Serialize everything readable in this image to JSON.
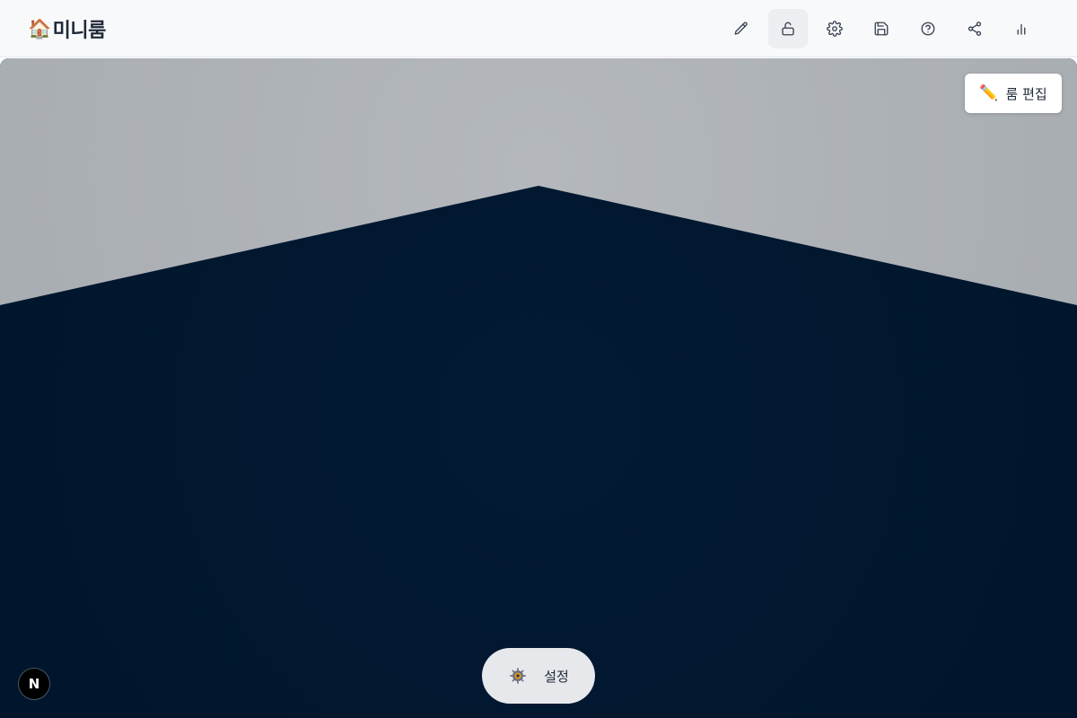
{
  "header": {
    "brand_emoji": "🏠",
    "brand_title": "미니룸",
    "toolbar": [
      {
        "icon": "pencil-icon",
        "active": false
      },
      {
        "icon": "unlock-icon",
        "active": true
      },
      {
        "icon": "gear-icon",
        "active": false
      },
      {
        "icon": "save-icon",
        "active": false
      },
      {
        "icon": "help-circle-icon",
        "active": false
      },
      {
        "icon": "share-icon",
        "active": false
      },
      {
        "icon": "bar-chart-icon",
        "active": false
      }
    ]
  },
  "stage": {
    "wall_color": "#a8adb2",
    "floor_color": "#00172e",
    "edit_button": {
      "icon": "pencil-emoji",
      "emoji": "✏️",
      "label": "룸 편집"
    },
    "settings_button": {
      "icon": "gear-emoji",
      "label": "설정"
    },
    "corner_badge": {
      "letter": "N"
    }
  }
}
